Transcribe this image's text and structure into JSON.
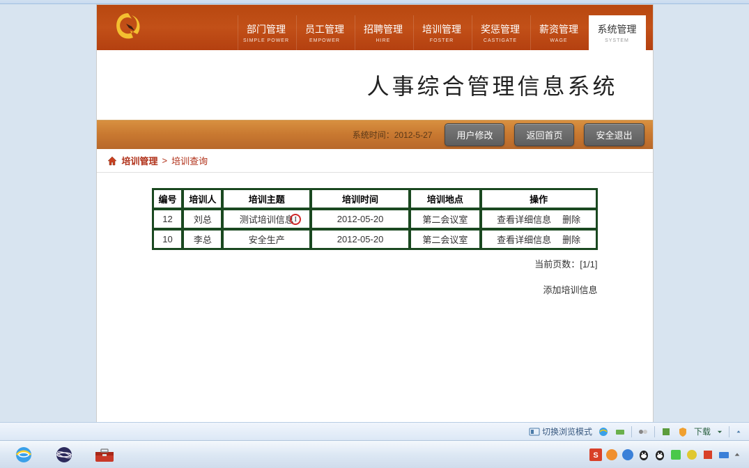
{
  "nav": {
    "items": [
      {
        "label": "部门管理",
        "en": "SIMPLE POWER"
      },
      {
        "label": "员工管理",
        "en": "EMPOWER"
      },
      {
        "label": "招聘管理",
        "en": "HIRE"
      },
      {
        "label": "培训管理",
        "en": "FOSTER"
      },
      {
        "label": "奖惩管理",
        "en": "CASTIGATE"
      },
      {
        "label": "薪资管理",
        "en": "WAGE"
      },
      {
        "label": "系统管理",
        "en": "SYSTEM",
        "active": true
      }
    ]
  },
  "title": "人事综合管理信息系统",
  "subheader": {
    "time_label": "系统时间：",
    "time_value": "2012-5-27",
    "btn_user": "用户修改",
    "btn_home": "返回首页",
    "btn_exit": "安全退出"
  },
  "breadcrumb": {
    "main": "培训管理",
    "sep": ">",
    "sub": "培训查询"
  },
  "table": {
    "headers": [
      "编号",
      "培训人",
      "培训主题",
      "培训时间",
      "培训地点",
      "操作"
    ],
    "rows": [
      {
        "id": "12",
        "trainer": "刘总",
        "topic": "测试培训信息",
        "time": "2012-05-20",
        "loc": "第二会议室"
      },
      {
        "id": "10",
        "trainer": "李总",
        "topic": "安全生产",
        "time": "2012-05-20",
        "loc": "第二会议室"
      }
    ],
    "op_view": "查看详细信息",
    "op_delete": "删除"
  },
  "pager": {
    "label": "当前页数：",
    "value": "[1/1]"
  },
  "add_link": "添加培训信息",
  "status": {
    "mode": "切换浏览模式",
    "download": "下载"
  }
}
